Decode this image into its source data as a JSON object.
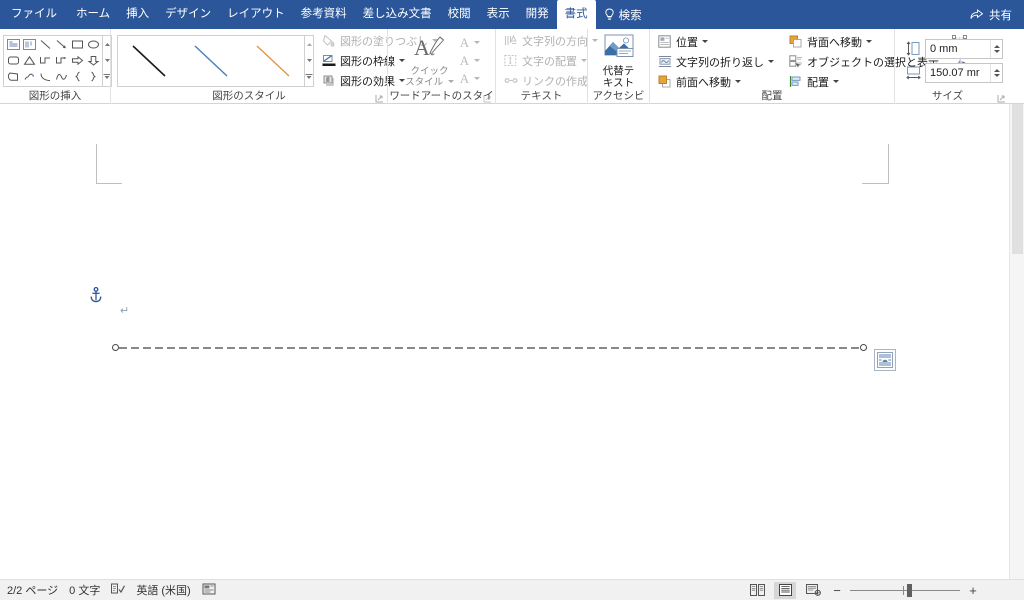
{
  "window": {
    "tabs": [
      {
        "label": "ファイル",
        "active": false,
        "is_file": true
      },
      {
        "label": "ホーム",
        "active": false
      },
      {
        "label": "挿入",
        "active": false
      },
      {
        "label": "デザイン",
        "active": false
      },
      {
        "label": "レイアウト",
        "active": false
      },
      {
        "label": "参考資料",
        "active": false
      },
      {
        "label": "差し込み文書",
        "active": false
      },
      {
        "label": "校閲",
        "active": false
      },
      {
        "label": "表示",
        "active": false
      },
      {
        "label": "開発",
        "active": false
      },
      {
        "label": "書式",
        "active": true
      }
    ],
    "tell_me": "検索",
    "share_label": "共有",
    "accent_color": "#2b579a"
  },
  "ribbon": {
    "groups": [
      {
        "id": "insert_shapes",
        "label": "図形の挿入",
        "shapes": [
          "textbox-icon",
          "vertical-textbox-icon",
          "line-icon",
          "line-arrow-icon",
          "rectangle-icon",
          "oval-icon",
          "rounded-rectangle-icon",
          "triangle-icon",
          "elbow-connector-icon",
          "elbow-arrow-connector-icon",
          "block-arrow-right-icon",
          "block-arrow-down-icon",
          "freeform-icon",
          "scribble-icon",
          "arc-icon",
          "curve-icon",
          "left-brace-icon",
          "right-brace-icon"
        ],
        "edit_shape": "edit-shape-icon",
        "draw_textbox": "draw-textbox-icon"
      },
      {
        "id": "shape_styles",
        "label": "図形のスタイル",
        "gallery": [
          {
            "name": "style-line-black",
            "color": "#1a1a1a"
          },
          {
            "name": "style-line-blue",
            "color": "#4a7ebb"
          },
          {
            "name": "style-line-orange",
            "color": "#e0903c"
          }
        ],
        "commands": [
          {
            "label": "図形の塗りつぶし",
            "icon": "fill-bucket-icon",
            "disabled": true,
            "has_caret": true
          },
          {
            "label": "図形の枠線",
            "icon": "shape-outline-icon",
            "disabled": false,
            "has_caret": true
          },
          {
            "label": "図形の効果",
            "icon": "shape-effects-icon",
            "disabled": false,
            "has_caret": true
          }
        ]
      },
      {
        "id": "wordart_styles",
        "label": "ワードアートのスタイル",
        "quick_styles_line1": "クイック",
        "quick_styles_line2": "スタイル",
        "a_buttons": [
          "text-fill-icon",
          "text-outline-icon",
          "text-effects-icon"
        ]
      },
      {
        "id": "text",
        "label": "テキスト",
        "commands": [
          {
            "label": "文字列の方向",
            "icon": "text-direction-icon",
            "disabled": true,
            "has_caret": true
          },
          {
            "label": "文字の配置",
            "icon": "align-text-icon",
            "disabled": true,
            "has_caret": true
          },
          {
            "label": "リンクの作成",
            "icon": "create-link-icon",
            "disabled": true,
            "has_caret": false
          }
        ]
      },
      {
        "id": "accessibility",
        "label": "アクセシビリティ",
        "alt_text_line1": "代替テ",
        "alt_text_line2": "キスト",
        "icon": "alt-text-picture-icon"
      },
      {
        "id": "arrange",
        "label": "配置",
        "commands": [
          {
            "label": "位置",
            "icon": "position-icon",
            "disabled": false,
            "has_caret": true
          },
          {
            "label": "文字列の折り返し",
            "icon": "wrap-text-icon",
            "disabled": false,
            "has_caret": true
          },
          {
            "label": "前面へ移動",
            "icon": "bring-forward-icon",
            "disabled": false,
            "has_caret": true
          },
          {
            "label": "背面へ移動",
            "icon": "send-backward-icon",
            "disabled": false,
            "has_caret": true
          },
          {
            "label": "オブジェクトの選択と表示",
            "icon": "selection-pane-icon",
            "disabled": false,
            "has_caret": false
          },
          {
            "label": "配置",
            "icon": "align-objects-icon",
            "disabled": false,
            "has_caret": true
          }
        ],
        "extra": [
          {
            "icon": "group-objects-icon",
            "has_caret": true
          },
          {
            "icon": "rotate-objects-icon",
            "has_caret": true
          }
        ]
      },
      {
        "id": "size",
        "label": "サイズ",
        "height": {
          "icon": "shape-height-icon",
          "value": "0 mm"
        },
        "width": {
          "icon": "shape-width-icon",
          "value": "150.07 mr"
        }
      }
    ]
  },
  "document": {
    "anchor_icon": "object-anchor-icon",
    "paragraph_mark": "↵",
    "shape": {
      "name": "dashed-line-shape",
      "line_color": "#111111",
      "dash": "8 4",
      "thickness": 2
    },
    "layout_options_icon": "layout-options-icon"
  },
  "status_bar": {
    "page_info": "2/2 ページ",
    "word_count": "0 文字",
    "proofing_icon": "proofing-errors-icon",
    "language": "英語 (米国)",
    "accessibility_icon": "accessibility-checker-icon",
    "views": [
      {
        "name": "read-mode-view",
        "icon": "read-mode-icon",
        "active": false
      },
      {
        "name": "print-layout-view",
        "icon": "print-layout-icon",
        "active": true
      },
      {
        "name": "web-layout-view",
        "icon": "web-layout-icon",
        "active": false
      }
    ],
    "zoom_out": "−",
    "zoom_in": "+",
    "zoom_level": ""
  }
}
